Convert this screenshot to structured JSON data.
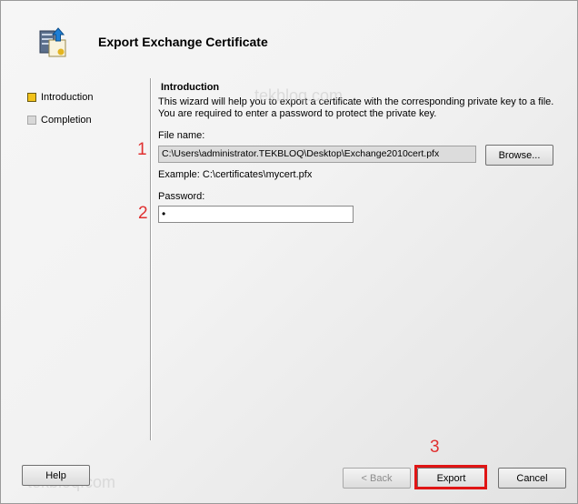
{
  "wizard": {
    "title": "Export Exchange Certificate",
    "icon": "certificate-export-icon"
  },
  "steps": [
    {
      "label": "Introduction",
      "state": "active"
    },
    {
      "label": "Completion",
      "state": "pending"
    }
  ],
  "intro": {
    "title": "Introduction",
    "description": "This wizard will help you to export a certificate with the corresponding private key to a file. You are required to enter a password to protect the private key."
  },
  "file": {
    "label": "File name:",
    "value": "C:\\Users\\administrator.TEKBLOQ\\Desktop\\Exchange2010cert.pfx",
    "browse_label": "Browse...",
    "example": "Example: C:\\certificates\\mycert.pfx"
  },
  "password": {
    "label": "Password:",
    "value": "•"
  },
  "callouts": [
    "1",
    "2",
    "3"
  ],
  "buttons": {
    "help": "Help",
    "back": "< Back",
    "export": "Export",
    "cancel": "Cancel"
  },
  "watermarks": [
    "tekbloq.com",
    "tekbloq.com"
  ],
  "colors": {
    "callout": "#e03030",
    "highlight": "#e01515",
    "active_step": "#f2c21a"
  }
}
